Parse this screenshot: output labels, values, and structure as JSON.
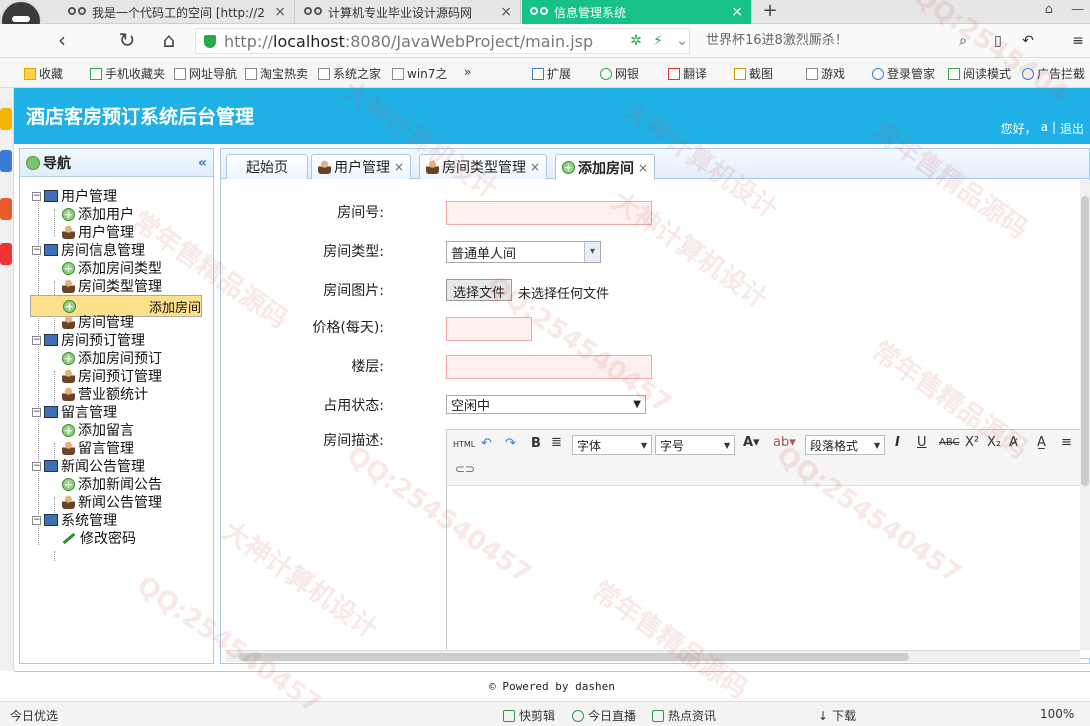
{
  "browser": {
    "tabs": [
      {
        "title": "我是一个代码工的空间 [http://2"
      },
      {
        "title": "计算机专业毕业设计源码网"
      },
      {
        "title": "信息管理系统"
      }
    ],
    "new_tab": "+",
    "url_host": "localhost",
    "url_scheme": "http://",
    "url_rest": ":8080/JavaWebProject/main.jsp",
    "search_hint": "世界杯16进8激烈厮杀！",
    "bookmarks": [
      "收藏",
      "手机收藏夹",
      "网址导航",
      "淘宝热卖",
      "系统之家",
      "win7之",
      "»",
      "扩展",
      "网银",
      "翻译",
      "截图",
      "游戏",
      "登录管家",
      "阅读模式",
      "广告拦截"
    ],
    "status_left": "今日优选",
    "status_items": [
      "快剪辑",
      "今日直播",
      "热点资讯"
    ],
    "status_download": "下载",
    "zoom": "100%"
  },
  "app": {
    "title": "酒店客房预订系统后台管理",
    "user_greeting": "您好，",
    "user_name": "a",
    "logout": "退出",
    "separator": "|",
    "footer": "© Powered by dashen"
  },
  "nav": {
    "title": "导航",
    "collapse": "«",
    "groups": [
      {
        "label": "用户管理",
        "items": [
          "添加用户",
          "用户管理"
        ]
      },
      {
        "label": "房间信息管理",
        "items": [
          "添加房间类型",
          "房间类型管理",
          "添加房间",
          "房间管理"
        ]
      },
      {
        "label": "房间预订管理",
        "items": [
          "添加房间预订",
          "房间预订管理",
          "营业额统计"
        ]
      },
      {
        "label": "留言管理",
        "items": [
          "添加留言",
          "留言管理"
        ]
      },
      {
        "label": "新闻公告管理",
        "items": [
          "添加新闻公告",
          "新闻公告管理"
        ]
      },
      {
        "label": "系统管理",
        "items": [
          "修改密码"
        ]
      }
    ],
    "selected": "添加房间"
  },
  "tabs": {
    "home": "起始页",
    "user_mgmt": "用户管理",
    "roomtype_mgmt": "房间类型管理",
    "add_room": "添加房间",
    "close": "×"
  },
  "form": {
    "room_no_label": "房间号:",
    "room_type_label": "房间类型:",
    "room_type_value": "普通单人间",
    "room_image_label": "房间图片:",
    "file_button": "选择文件",
    "file_none": "未选择任何文件",
    "price_label": "价格(每天):",
    "floor_label": "楼层:",
    "status_label": "占用状态:",
    "status_value": "空闲中",
    "desc_label": "房间描述:"
  },
  "editor": {
    "html": "HTML",
    "font": "字体",
    "size": "字号",
    "paragraph": "段落格式"
  },
  "watermark": [
    "QQ:2545404",
    "大神计算机设计",
    "常年售精品源码",
    "QQ:254540457",
    "大神计算机设计",
    "常年售精品源码",
    "QQ:254540457",
    "大神计算机设计",
    "QQ:254540457",
    "常年售精品源码",
    "QQ:254540457",
    "大神计算机设计",
    "常年售精品源码"
  ]
}
